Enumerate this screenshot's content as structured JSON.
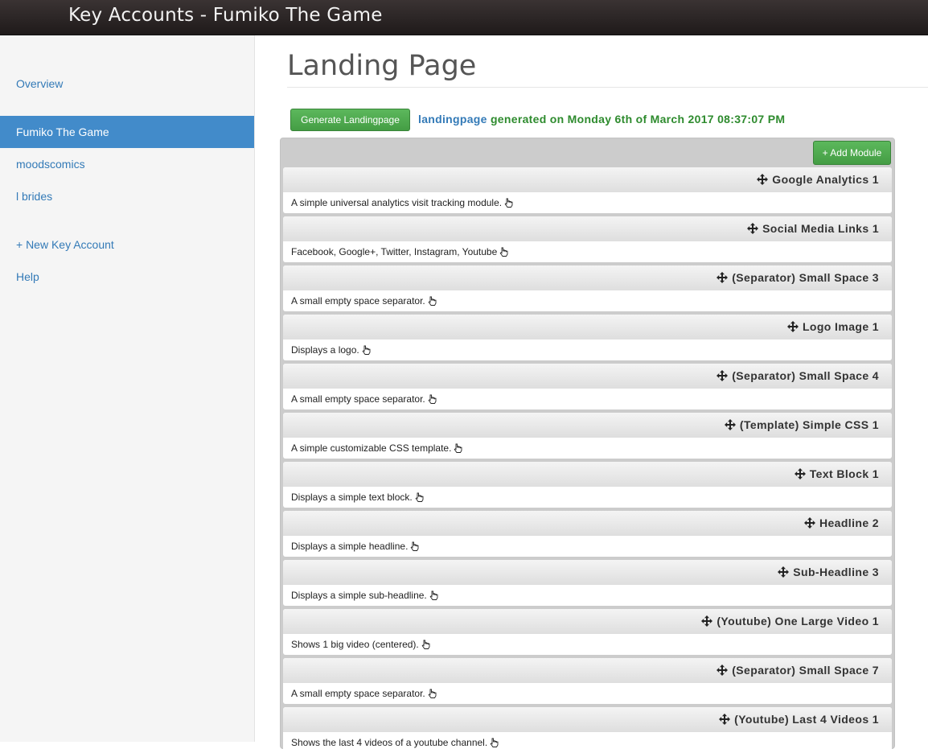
{
  "header": {
    "title": "Key Accounts - Fumiko The Game"
  },
  "sidebar": {
    "items": [
      {
        "label": "Overview"
      },
      {
        "label": "Fumiko The Game"
      },
      {
        "label": "moodscomics"
      },
      {
        "label": "l brides"
      },
      {
        "label": "+ New Key Account"
      },
      {
        "label": "Help"
      }
    ]
  },
  "main": {
    "title": "Landing Page",
    "generate_label": "Generate Landingpage",
    "status_link": "landingpage",
    "status_text": "generated on Monday 6th of March 2017 08:37:07 PM",
    "add_module_label": "+ Add Module",
    "modules": [
      {
        "title": "Google Analytics 1",
        "description": "A simple universal analytics visit tracking module."
      },
      {
        "title": "Social Media Links 1",
        "description": "Facebook, Google+, Twitter, Instagram, Youtube"
      },
      {
        "title": "(Separator) Small Space 3",
        "description": "A small empty space separator."
      },
      {
        "title": "Logo Image 1",
        "description": "Displays a logo."
      },
      {
        "title": "(Separator) Small Space 4",
        "description": "A small empty space separator."
      },
      {
        "title": "(Template) Simple CSS 1",
        "description": "A simple customizable CSS template."
      },
      {
        "title": "Text Block 1",
        "description": "Displays a simple text block."
      },
      {
        "title": "Headline 2",
        "description": "Displays a simple headline."
      },
      {
        "title": "Sub-Headline 3",
        "description": "Displays a simple sub-headline."
      },
      {
        "title": "(Youtube) One Large Video 1",
        "description": "Shows 1 big video (centered)."
      },
      {
        "title": "(Separator) Small Space 7",
        "description": "A small empty space separator."
      },
      {
        "title": "(Youtube) Last 4 Videos 1",
        "description": "Shows the last 4 videos of a youtube channel."
      }
    ]
  },
  "icons": {
    "move": "move-arrows-icon",
    "edit": "pointing-hand-icon"
  },
  "colors": {
    "accent": "#428bca",
    "success": "#5cb85c",
    "status_green": "#2e8b2e",
    "link": "#337ab7"
  }
}
